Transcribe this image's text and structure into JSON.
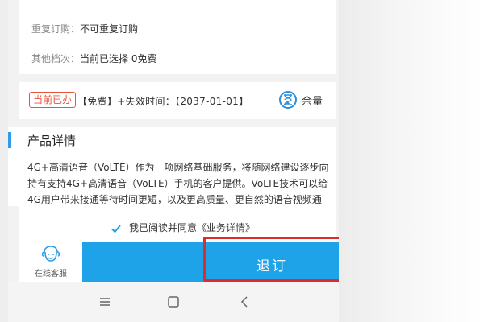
{
  "info": {
    "repeat_label": "重复订购：",
    "repeat_value": "不可重复订购",
    "tier_label": "其他档次：",
    "tier_value": "当前已选择 0免费"
  },
  "status": {
    "badge": "当前已办",
    "text": "【免费】+失效时间：【2037-01-01】",
    "balance_label": "余量"
  },
  "detail": {
    "title": "产品详情",
    "body": "4G+高清语音（VoLTE）作为一项网络基础服务，将随网络建设逐步向\n持有支持4G+高清语音（VoLTE）手机的客户提供。VoLTE技术可以给\n4G用户带来接通等待时间更短，以及更高质量、更自然的语音视频通"
  },
  "agreement": {
    "checked": true,
    "text": "我已阅读并同意《业务详情》"
  },
  "bottom": {
    "service_label": "在线客服",
    "unsubscribe_label": "退订"
  },
  "colors": {
    "accent": "#1fa3e8",
    "badge": "#e5553b",
    "highlight": "#e02b2b"
  },
  "icons": [
    "hourglass-icon",
    "checkbox-icon",
    "customer-service-icon",
    "menu-icon",
    "home-icon",
    "back-icon"
  ]
}
